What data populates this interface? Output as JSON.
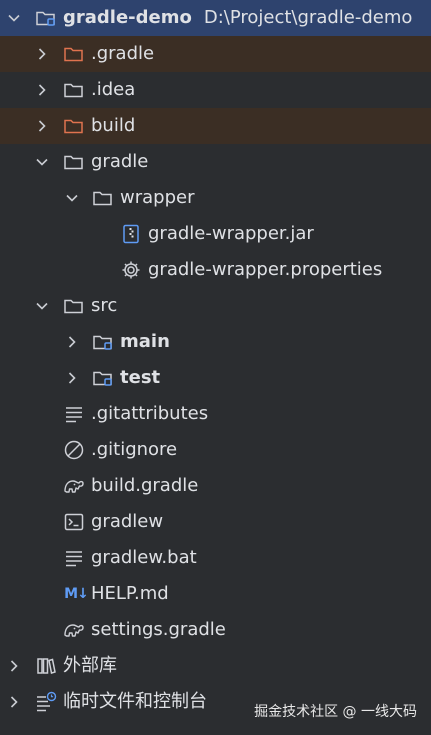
{
  "project": {
    "root_name": "gradle-demo",
    "root_path": "D:\\Project\\gradle-demo"
  },
  "tree": {
    "dot_gradle": ".gradle",
    "dot_idea": ".idea",
    "build": "build",
    "gradle": "gradle",
    "wrapper": "wrapper",
    "wrapper_jar": "gradle-wrapper.jar",
    "wrapper_properties": "gradle-wrapper.properties",
    "src": "src",
    "main": "main",
    "test": "test",
    "gitattributes": ".gitattributes",
    "gitignore": ".gitignore",
    "build_gradle": "build.gradle",
    "gradlew": "gradlew",
    "gradlew_bat": "gradlew.bat",
    "help_md": "HELP.md",
    "settings_gradle": "settings.gradle",
    "external_libraries": "外部库",
    "scratches": "临时文件和控制台"
  },
  "icons": {
    "md_badge": "M↓"
  },
  "watermark": "掘金技术社区 @ 一线大码",
  "colors": {
    "background": "#2b2d30",
    "selected_row": "#2e436e",
    "excluded_row": "#3b2e24",
    "excluded_folder": "#e0734f",
    "accent_blue": "#5f9cf5",
    "text": "#dfe1e5"
  }
}
